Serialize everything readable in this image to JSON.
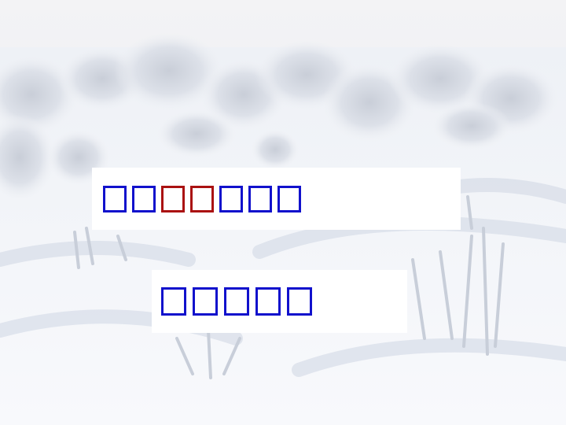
{
  "scene": {
    "description_icon": "snowy-landscape-image"
  },
  "lines": [
    {
      "glyphs": [
        {
          "color": "#1111cc"
        },
        {
          "color": "#1111cc"
        },
        {
          "color": "#aa1111"
        },
        {
          "color": "#aa1111"
        },
        {
          "color": "#1111cc"
        },
        {
          "color": "#1111cc"
        },
        {
          "color": "#1111cc"
        }
      ]
    },
    {
      "glyphs": [
        {
          "color": "#1111cc"
        },
        {
          "color": "#1111cc"
        },
        {
          "color": "#1111cc"
        },
        {
          "color": "#1111cc"
        },
        {
          "color": "#1111cc"
        }
      ]
    }
  ],
  "colors": {
    "text_blue": "#1111cc",
    "text_red": "#aa1111",
    "snow": "#f4f6fa",
    "shadow": "#d7dde8"
  }
}
